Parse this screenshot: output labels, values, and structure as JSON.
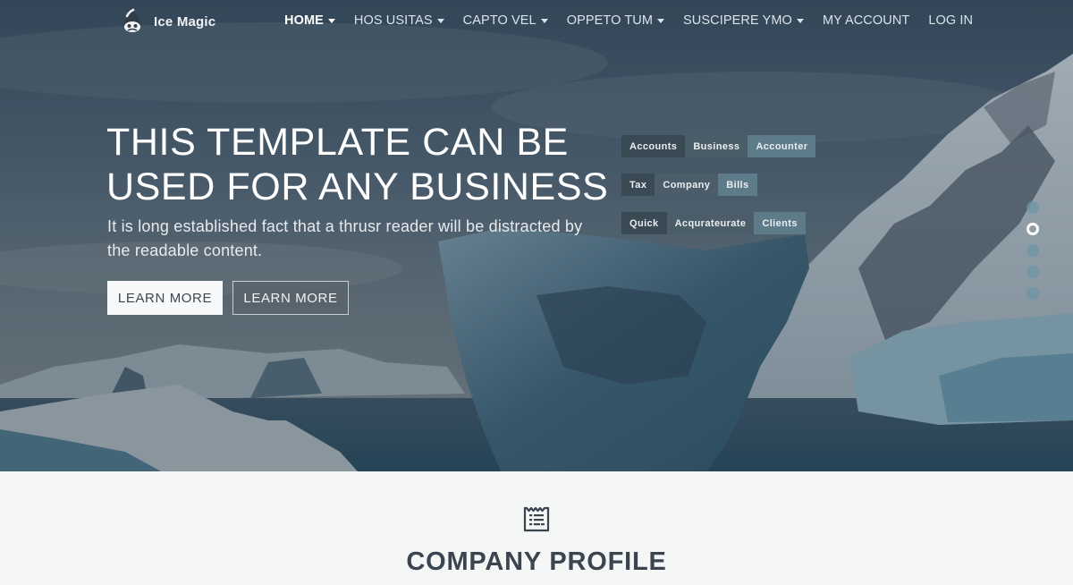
{
  "brand": {
    "name": "Ice Magic",
    "icon": "drop-logo-icon"
  },
  "nav": {
    "items": [
      {
        "label": "HOME",
        "has_dropdown": true,
        "active": true
      },
      {
        "label": "HOS USITAS",
        "has_dropdown": true,
        "active": false
      },
      {
        "label": "CAPTO VEL",
        "has_dropdown": true,
        "active": false
      },
      {
        "label": "OPPETO TUM",
        "has_dropdown": true,
        "active": false
      },
      {
        "label": "SUSCIPERE YMO",
        "has_dropdown": true,
        "active": false
      },
      {
        "label": "MY ACCOUNT",
        "has_dropdown": false,
        "active": false
      },
      {
        "label": "LOG IN",
        "has_dropdown": false,
        "active": false
      }
    ]
  },
  "hero": {
    "headline_line1": "THIS TEMPLATE CAN BE",
    "headline_line2": "USED FOR ANY BUSINESS",
    "subtext": "It is long established fact that a thrusr reader will be distracted by the readable content.",
    "buttons": [
      {
        "label": "LEARN MORE",
        "style": "solid"
      },
      {
        "label": "LEARN MORE",
        "style": "outline"
      }
    ],
    "tag_rows": [
      [
        {
          "label": "Accounts",
          "shade": "dark"
        },
        {
          "label": "Business",
          "shade": "mid"
        },
        {
          "label": "Accounter",
          "shade": "light"
        }
      ],
      [
        {
          "label": "Tax",
          "shade": "dark"
        },
        {
          "label": "Company",
          "shade": "mid"
        },
        {
          "label": "Bills",
          "shade": "light"
        }
      ],
      [
        {
          "label": "Quick",
          "shade": "dark"
        },
        {
          "label": "Acqurateurate",
          "shade": "mid"
        },
        {
          "label": "Clients",
          "shade": "light"
        }
      ]
    ],
    "slider": {
      "total_slides": 5,
      "active_slide": 2
    }
  },
  "profile_section": {
    "icon": "document-list-icon",
    "title": "COMPANY PROFILE"
  },
  "colors": {
    "tag_dark": "#3a4a55",
    "tag_mid": "#4b5d69",
    "tag_light": "#5e7b8a",
    "section_bg": "#f5f7f7",
    "title_text": "#3a4550"
  }
}
